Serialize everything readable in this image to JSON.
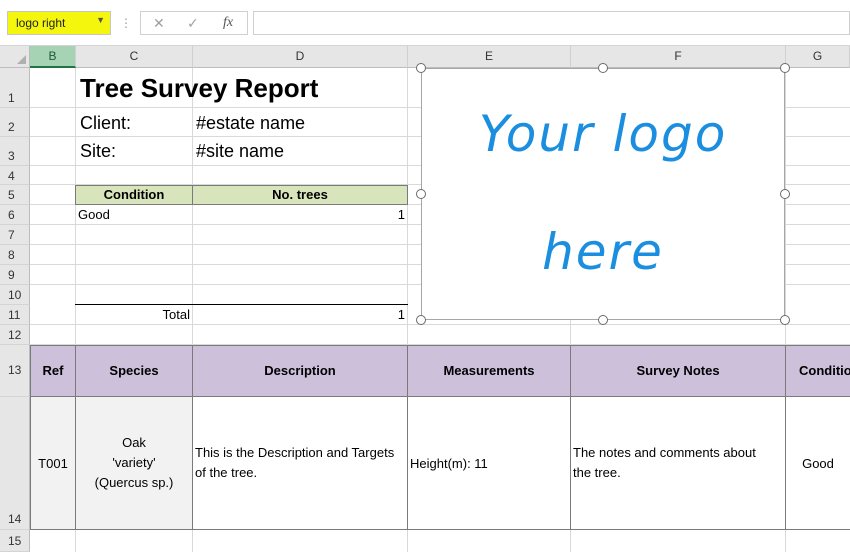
{
  "namebox": {
    "value": "logo right",
    "dropdown_icon": "chevron-down-icon"
  },
  "formula_bar": {
    "cancel_icon": "✕",
    "enter_icon": "✓",
    "fx_label": "fx",
    "content": ""
  },
  "columns": [
    "B",
    "C",
    "D",
    "E",
    "F",
    "G"
  ],
  "rows": [
    "1",
    "2",
    "3",
    "4",
    "5",
    "6",
    "7",
    "8",
    "9",
    "10",
    "11",
    "12",
    "13",
    "14",
    "15"
  ],
  "report": {
    "title": "Tree Survey Report",
    "client_label": "Client:",
    "client_value": "#estate name",
    "site_label": "Site:",
    "site_value": "#site name"
  },
  "summary_table": {
    "headers": [
      "Condition",
      "No. trees"
    ],
    "rows": [
      {
        "condition": "Good",
        "count": "1"
      }
    ],
    "total_label": "Total",
    "total_value": "1"
  },
  "logo": {
    "line1": "Your logo",
    "line2": "here"
  },
  "survey_table": {
    "headers": [
      "Ref",
      "Species",
      "Description",
      "Measurements",
      "Survey Notes",
      "Conditio"
    ],
    "row": {
      "ref": "T001",
      "species_line1": "Oak",
      "species_line2": "'variety'",
      "species_line3": "(Quercus sp.)",
      "description_line1": "This is the Description and Targets",
      "description_line2": "of the tree.",
      "measurements": "Height(m): 11",
      "notes_line1": "The notes and comments about",
      "notes_line2": "the tree.",
      "condition": "Good"
    }
  },
  "colors": {
    "namebox_highlight": "#f4f60d",
    "green_header": "#d8e4bc",
    "purple_header": "#ccc0da",
    "logo_text": "#1b8ee0",
    "selected_col": "#a5d3b3"
  }
}
